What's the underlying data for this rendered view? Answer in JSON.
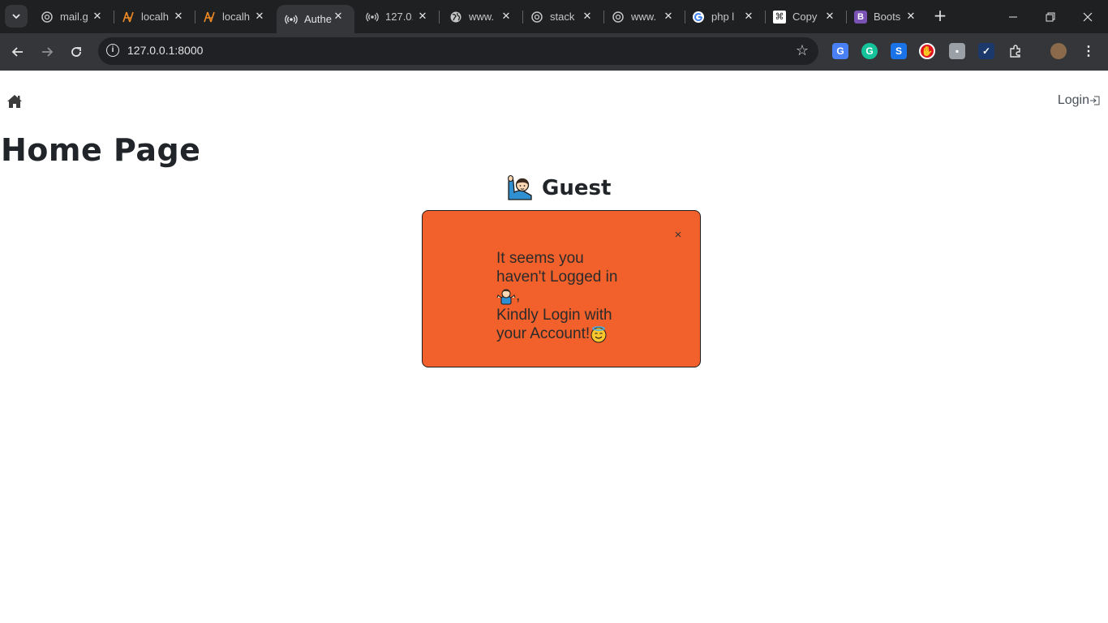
{
  "browser": {
    "tabs": [
      {
        "label": "mail.g",
        "icon": "chatgpt-icon"
      },
      {
        "label": "localh",
        "icon": "xampp-icon"
      },
      {
        "label": "localh",
        "icon": "xampp-icon"
      },
      {
        "label": "Authe",
        "icon": "broadcast-icon",
        "active": true
      },
      {
        "label": "127.0.",
        "icon": "broadcast-icon"
      },
      {
        "label": "www.",
        "icon": "globe-icon"
      },
      {
        "label": "stack",
        "icon": "chatgpt-icon"
      },
      {
        "label": "www.",
        "icon": "chatgpt-icon"
      },
      {
        "label": "php l",
        "icon": "google-icon"
      },
      {
        "label": "Copy",
        "icon": "command-icon"
      },
      {
        "label": "Boots",
        "icon": "bootstrap-icon"
      }
    ],
    "address": "127.0.0.1:8000"
  },
  "page": {
    "login_label": "Login",
    "title": "Home Page",
    "guest_label": "Guest",
    "alert": {
      "close_symbol": "×",
      "line1": "It seems you",
      "line2": "haven't Logged in",
      "line3_suffix": ",",
      "line4": "Kindly Login with",
      "line5": "your Account!"
    }
  },
  "colors": {
    "alert_bg": "#f2612b",
    "tabstrip": "#1f2022",
    "toolbar": "#35363a"
  }
}
